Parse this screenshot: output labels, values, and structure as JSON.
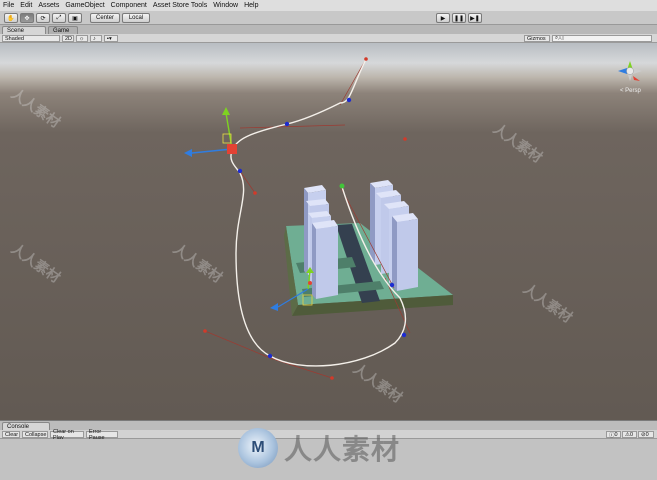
{
  "menu": [
    "File",
    "Edit",
    "Assets",
    "GameObject",
    "Component",
    "Asset Store Tools",
    "Window",
    "Help"
  ],
  "toolbar": {
    "hand": "✋",
    "move": "✥",
    "rotate": "⟳",
    "scale": "⤢",
    "rect": "▣",
    "pivot": "Center",
    "space": "Local",
    "play": "▶",
    "pause": "❚❚",
    "step": "▶❚"
  },
  "tabs": {
    "scene": "Scene",
    "game": "Game"
  },
  "scenebar": {
    "shading": "Shaded",
    "mode2d": "2D",
    "gizmos": "Gizmos",
    "search": "All"
  },
  "gizmo": {
    "persp": "< Persp"
  },
  "console": {
    "tab": "Console",
    "clear": "Clear",
    "collapse": "Collapse",
    "clear_on_play": "Clear on Play",
    "error_pause": "Error Pause",
    "count_log": "0",
    "count_warn": "0",
    "count_err": "0"
  },
  "watermarks": {
    "small": "人人素材",
    "big": "人人素材",
    "logo": "M"
  },
  "colors": {
    "sky": "#d6d8da",
    "ground": "#625a53",
    "platform": "#6fae93",
    "building": "#c6cfee",
    "path": "#f4f0ea",
    "handle": "#1d2bd1",
    "x_axis": "#e34234",
    "y_axis": "#7ed321",
    "z_axis": "#2f7de1"
  }
}
